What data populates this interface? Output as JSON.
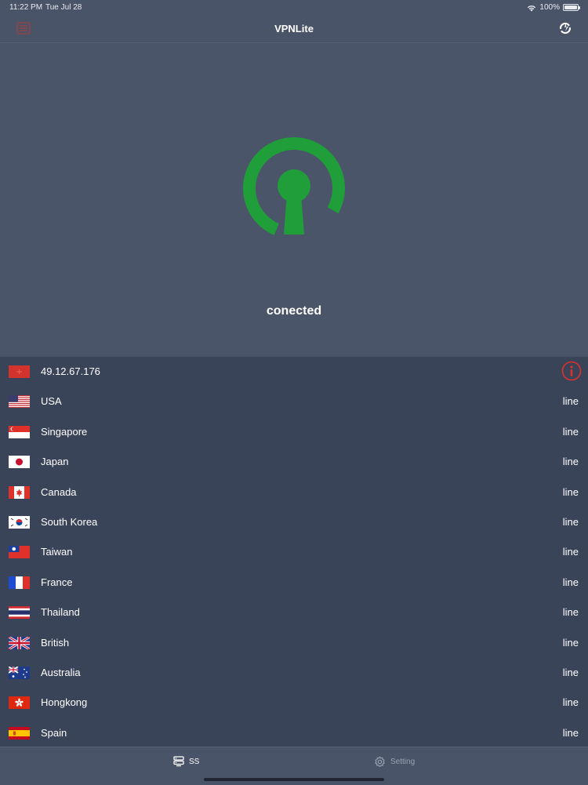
{
  "status_bar": {
    "time": "11:22 PM",
    "date": "Tue Jul 28",
    "battery": "100%"
  },
  "nav": {
    "title": "VPNLite",
    "left_icon": "list-icon",
    "right_icon": "refresh-icon"
  },
  "hero": {
    "status": "conected",
    "logo_color": "#1f9e3a"
  },
  "servers": [
    {
      "name": "49.12.67.176",
      "right": "",
      "flag": "current"
    },
    {
      "name": "USA",
      "right": "line",
      "flag": "usa"
    },
    {
      "name": "Singapore",
      "right": "line",
      "flag": "singapore"
    },
    {
      "name": "Japan",
      "right": "line",
      "flag": "japan"
    },
    {
      "name": "Canada",
      "right": "line",
      "flag": "canada"
    },
    {
      "name": "South Korea",
      "right": "line",
      "flag": "south-korea"
    },
    {
      "name": "Taiwan",
      "right": "line",
      "flag": "taiwan"
    },
    {
      "name": "France",
      "right": "line",
      "flag": "france"
    },
    {
      "name": "Thailand",
      "right": "line",
      "flag": "thailand"
    },
    {
      "name": "British",
      "right": "line",
      "flag": "british"
    },
    {
      "name": "Australia",
      "right": "line",
      "flag": "australia"
    },
    {
      "name": "Hongkong",
      "right": "line",
      "flag": "hongkong"
    },
    {
      "name": "Spain",
      "right": "line",
      "flag": "spain"
    }
  ],
  "tabs": {
    "ss": "SS",
    "setting": "Setting"
  },
  "colors": {
    "background": "#3a4459",
    "bar": "#4a5468",
    "accent_red": "#e0302a",
    "connected_green": "#1f9e3a"
  }
}
